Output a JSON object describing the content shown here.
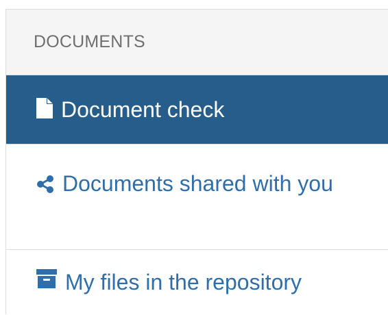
{
  "panel": {
    "header": "DOCUMENTS",
    "items": [
      {
        "label": "Document check",
        "icon": "file-icon",
        "active": true
      },
      {
        "label": "Documents shared with you",
        "icon": "share-icon",
        "active": false
      },
      {
        "label": "My files in the repository",
        "icon": "archive-icon",
        "active": false
      }
    ]
  },
  "colors": {
    "active_bg": "#275d8b",
    "link": "#2f6ea8",
    "header_bg": "#f5f5f5",
    "header_text": "#6f6f6f"
  }
}
